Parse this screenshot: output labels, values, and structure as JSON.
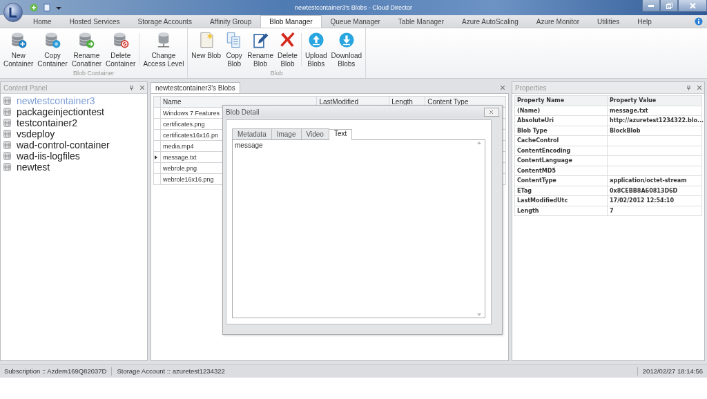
{
  "window": {
    "title": "newtestcontainer3's Blobs - Cloud Director"
  },
  "menu_tabs": [
    {
      "label": "Home",
      "selected": false
    },
    {
      "label": "Hosted Services",
      "selected": false
    },
    {
      "label": "Storage Accounts",
      "selected": false
    },
    {
      "label": "Affinity Group",
      "selected": false
    },
    {
      "label": "Blob Manager",
      "selected": true
    },
    {
      "label": "Queue Manager",
      "selected": false
    },
    {
      "label": "Table Manager",
      "selected": false
    },
    {
      "label": "Azure AutoScaling",
      "selected": false
    },
    {
      "label": "Azure Monitor",
      "selected": false
    },
    {
      "label": "Utilities",
      "selected": false
    },
    {
      "label": "Help",
      "selected": false
    }
  ],
  "ribbon_groups": [
    {
      "title": "Blob Container",
      "buttons": [
        {
          "lines": [
            "New",
            "Container"
          ]
        },
        {
          "lines": [
            "Copy",
            "Container"
          ]
        },
        {
          "lines": [
            "Rename",
            "Conatiner"
          ]
        },
        {
          "lines": [
            "Delete",
            "Container"
          ]
        },
        {
          "lines": [
            "Change",
            "Access Level"
          ]
        }
      ]
    },
    {
      "title": "Blob",
      "buttons": [
        {
          "lines": [
            "New Blob"
          ]
        },
        {
          "lines": [
            "Copy",
            "Blob"
          ]
        },
        {
          "lines": [
            "Rename",
            "Blob"
          ]
        },
        {
          "lines": [
            "Delete",
            "Blob"
          ]
        },
        {
          "lines": [
            "Upload",
            "Blobs"
          ]
        },
        {
          "lines": [
            "Download",
            "Blobs"
          ]
        }
      ]
    }
  ],
  "content_panel": {
    "title": "Content Panel",
    "items": [
      {
        "label": "newtestcontainer3",
        "selected": true
      },
      {
        "label": "packageinjectiontest",
        "selected": false
      },
      {
        "label": "testcontainer2",
        "selected": false
      },
      {
        "label": "vsdeploy",
        "selected": false
      },
      {
        "label": "wad-control-container",
        "selected": false
      },
      {
        "label": "wad-iis-logfiles",
        "selected": false
      },
      {
        "label": "newtest",
        "selected": false
      }
    ]
  },
  "document_tab": {
    "title": "newtestcontainer3's Blobs"
  },
  "blob_grid": {
    "columns": [
      "Name",
      "LastModified",
      "Length",
      "Content Type"
    ],
    "rows": [
      {
        "name": "Windows 7 Features",
        "selected": false
      },
      {
        "name": "certificates.png",
        "selected": false
      },
      {
        "name": "certificates16x16.pn",
        "selected": false
      },
      {
        "name": "media.mp4",
        "selected": false
      },
      {
        "name": "message.txt",
        "selected": true
      },
      {
        "name": "webrole.png",
        "selected": false
      },
      {
        "name": "webrole16x16.png",
        "selected": false
      }
    ]
  },
  "blob_detail": {
    "title": "Blob Detail",
    "tabs": [
      {
        "label": "Metadata",
        "selected": false
      },
      {
        "label": "Image",
        "selected": false
      },
      {
        "label": "Video",
        "selected": false
      },
      {
        "label": "Text",
        "selected": true
      }
    ],
    "text": "message"
  },
  "properties": {
    "title": "Properties",
    "columns": [
      "Property Name",
      "Property Value"
    ],
    "rows": [
      {
        "name": "(Name)",
        "value": "message.txt"
      },
      {
        "name": "AbsoluteUri",
        "value": "http://azuretest1234322.blo..."
      },
      {
        "name": "Blob Type",
        "value": "BlockBlob"
      },
      {
        "name": "CacheControl"
      },
      {
        "name": "ContentEncoding"
      },
      {
        "name": "ContentLanguage"
      },
      {
        "name": "ContentMD5"
      },
      {
        "name": "ContentType",
        "value": "application/octet-stream"
      },
      {
        "name": "ETag",
        "value": "0x8CEBB8A60813D6D"
      },
      {
        "name": "LastModifiedUtc",
        "value": "17/02/2012 12:54:10"
      },
      {
        "name": "Length",
        "value": "7"
      }
    ]
  },
  "status_bar": {
    "subscription": "Subscription :: Azdem169Q82037D",
    "storage_account": "Storage Account :: azuretest1234322",
    "datetime": "2012/02/27 18:14:56"
  }
}
